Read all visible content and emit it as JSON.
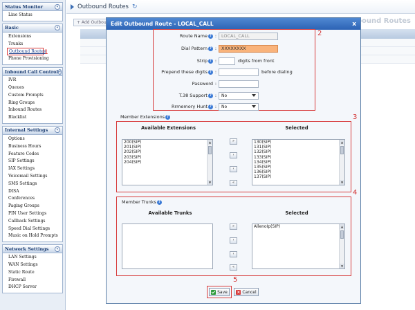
{
  "sidebar": {
    "sections": [
      {
        "title": "Status Monitor",
        "items": [
          "Line Status"
        ]
      },
      {
        "title": "Basic",
        "items": [
          "Extensions",
          "Trunks",
          "Outbound Routes",
          "Phone Provisioning"
        ]
      },
      {
        "title": "Inbound Call Control",
        "items": [
          "IVR",
          "Queues",
          "Custom Prompts",
          "Ring Groups",
          "Inbound Routes",
          "Blacklist"
        ]
      },
      {
        "title": "Internal Settings",
        "items": [
          "Options",
          "Business Hours",
          "Feature Codes",
          "SIP Settings",
          "IAX Settings",
          "Voicemail Settings",
          "SMS Settings",
          "DISA",
          "Conferences",
          "Paging Groups",
          "PIN User Settings",
          "Callback Settings",
          "Speed Dial Settings",
          "Music on Hold Prompts"
        ]
      },
      {
        "title": "Network Settings",
        "items": [
          "LAN Settings",
          "WAN Settings",
          "Static Route",
          "Firewall",
          "DHCP Server"
        ]
      }
    ],
    "collapse_symbol": "«",
    "highlighted_tag": "1"
  },
  "page": {
    "title": "Outbound Routes",
    "toolbar_add": "+ Add Outbou",
    "bg_heading": "Outbound Routes"
  },
  "dialog": {
    "title": "Edit Outbound Route - LOCAL_CALL",
    "close": "x",
    "tags": {
      "fields": "2",
      "extensions": "3",
      "trunks": "4",
      "buttons": "5"
    },
    "help_symbol": "?",
    "fields": {
      "route_name": {
        "label": "Route Name",
        "value": "LOCAL_CALL"
      },
      "dial_pattern": {
        "label": "Dial Pattern",
        "value": "XXXXXXXX"
      },
      "strip": {
        "label": "Strip",
        "value": "",
        "after": "digits from front"
      },
      "prepend": {
        "label": "Prepend these digits",
        "value": "",
        "after": "before dialing"
      },
      "password": {
        "label": "Password",
        "value": ""
      },
      "t38": {
        "label": "T.38 Support",
        "value": "No"
      },
      "rrmemory": {
        "label": "Rrmemory Hunt",
        "value": "No"
      }
    },
    "member_extensions": {
      "label": "Member Extensions",
      "available_label": "Available Extensions",
      "selected_label": "Selected",
      "available": [
        "200(SIP)",
        "201(SIP)",
        "202(SIP)",
        "203(SIP)",
        "204(SIP)"
      ],
      "selected": [
        "130(SIP)",
        "131(SIP)",
        "132(SIP)",
        "133(SIP)",
        "134(SIP)",
        "135(SIP)",
        "136(SIP)",
        "137(SIP)"
      ]
    },
    "member_trunks": {
      "label": "Member Trunks",
      "available_label": "Available Trunks",
      "selected_label": "Selected",
      "available": [],
      "selected": [
        "AllenoIp(SIP)"
      ]
    },
    "move_buttons": {
      "all_right": "»",
      "right": "›",
      "left": "‹",
      "all_left": "«"
    },
    "save_label": "Save",
    "cancel_label": "Cancel"
  }
}
